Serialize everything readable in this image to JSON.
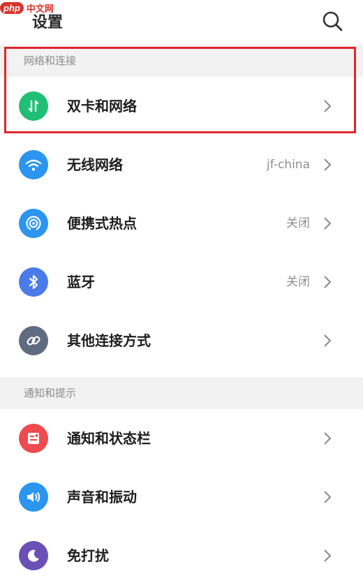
{
  "watermark": {
    "logo": "php",
    "text": "中文网"
  },
  "header": {
    "title": "设置"
  },
  "sections": [
    {
      "title": "网络和连接"
    },
    {
      "title": "通知和提示"
    }
  ],
  "rows": [
    {
      "label": "双卡和网络",
      "value": "",
      "icon": "dual-sim-icon",
      "color": "#1fbf75"
    },
    {
      "label": "无线网络",
      "value": "jf-china",
      "icon": "wifi-icon",
      "color": "#2b95ef"
    },
    {
      "label": "便携式热点",
      "value": "关闭",
      "icon": "hotspot-icon",
      "color": "#2b95ef"
    },
    {
      "label": "蓝牙",
      "value": "关闭",
      "icon": "bluetooth-icon",
      "color": "#4a7be8"
    },
    {
      "label": "其他连接方式",
      "value": "",
      "icon": "link-icon",
      "color": "#5e6b80"
    },
    {
      "label": "通知和状态栏",
      "value": "",
      "icon": "notification-icon",
      "color": "#ef4a4f"
    },
    {
      "label": "声音和振动",
      "value": "",
      "icon": "sound-icon",
      "color": "#2b95ef"
    },
    {
      "label": "免打扰",
      "value": "",
      "icon": "moon-icon",
      "color": "#6a4fb6"
    }
  ]
}
